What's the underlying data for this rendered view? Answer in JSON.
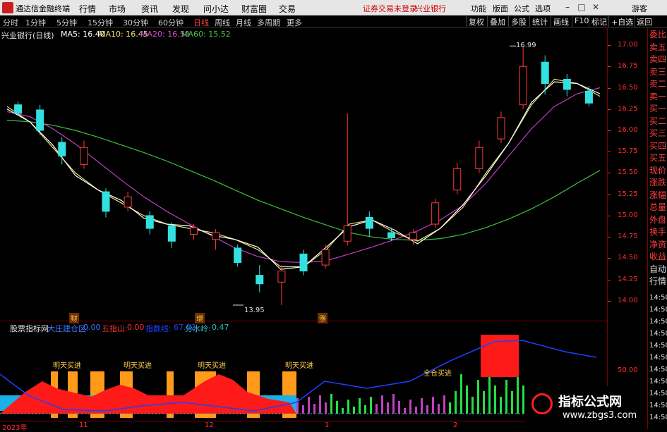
{
  "titlebar": {
    "app_name": "通达信金融终端",
    "menus": [
      "行情",
      "市场",
      "资讯",
      "发现",
      "问小达",
      "财富圈",
      "交易"
    ],
    "warning": "证券交易未登录",
    "stock": "兴业银行",
    "right_menus": [
      "功能",
      "版面",
      "公式",
      "选项"
    ],
    "guest": "游客"
  },
  "toolbar": {
    "periods": [
      "分时",
      "1分钟",
      "5分钟",
      "15分钟",
      "30分钟",
      "60分钟",
      "日线",
      "周线",
      "月线",
      "多周期",
      "更多"
    ],
    "active_period": "日线",
    "right_tools": [
      "复权",
      "叠加",
      "多股",
      "统计",
      "画线",
      "F10",
      "标记",
      "+自选",
      "返回"
    ]
  },
  "legend": {
    "stock_title": "兴业银行(日线)",
    "ma5": "MA5: 16.40",
    "ma10": "MA10: 16.45",
    "ma20": "MA20: 16.50",
    "ma60": "MA60: 15.52"
  },
  "price_axis": [
    "17.00",
    "16.75",
    "16.50",
    "16.25",
    "16.00",
    "15.75",
    "15.50",
    "15.25",
    "15.00",
    "14.75",
    "14.50",
    "14.25",
    "14.00"
  ],
  "annotations": {
    "high": "16.99",
    "low": "13.95",
    "tags": [
      "财",
      "增",
      "涨"
    ]
  },
  "indicator": {
    "name": "股票指标网",
    "items": [
      {
        "label": "大庄建仓区:",
        "value": "0.00",
        "color": "#3a78ff"
      },
      {
        "label": "五指山:",
        "value": "0.00",
        "color": "#ff3030"
      },
      {
        "label": "指数线:",
        "value": "67.82",
        "color": "#2040ff"
      },
      {
        "label": "分水岭:",
        "value": "0.47",
        "color": "#30c0c0"
      }
    ],
    "signals": [
      "明天买进",
      "明天买进",
      "明天买进",
      "明天买进"
    ],
    "full_position": "全仓买进",
    "axis": [
      "50.00"
    ]
  },
  "side_panel": [
    "委比",
    "卖五",
    "卖四",
    "卖三",
    "卖二",
    "卖一",
    "买一",
    "买二",
    "买三",
    "买四",
    "买五",
    "现价",
    "涨跌",
    "涨幅",
    "总量",
    "外盘",
    "换手",
    "净资",
    "收益",
    "自动",
    "行情"
  ],
  "side_right_axis": [
    "14:50",
    "14:50",
    "14:50",
    "14:50",
    "14:50",
    "14:50",
    "14:50",
    "14:50",
    "14:50",
    "14:50",
    "14:50"
  ],
  "date_axis": [
    "2023年",
    "11",
    "12",
    "1",
    "2"
  ],
  "watermark": {
    "title": "指标公式网",
    "url": "www.zbgs3.com"
  },
  "colors": {
    "up": "#ff3c3c",
    "down": "#33e0e0",
    "ma5": "#ffffff",
    "ma10": "#e8e070",
    "ma20": "#c040c0",
    "ma60": "#40c040"
  },
  "chart_data": {
    "type": "candlestick",
    "ylim": [
      13.9,
      17.05
    ],
    "ma60": [
      16.12,
      16.1,
      16.06,
      16.0,
      15.92,
      15.83,
      15.74,
      15.64,
      15.53,
      15.42,
      15.3,
      15.18,
      15.08,
      14.98,
      14.89,
      14.8,
      14.75,
      14.72,
      14.71,
      14.73,
      14.78,
      14.86,
      14.96,
      15.08,
      15.22,
      15.38,
      15.53
    ],
    "ma20": [
      16.22,
      16.16,
      16.02,
      15.84,
      15.63,
      15.42,
      15.22,
      15.05,
      14.9,
      14.76,
      14.62,
      14.52,
      14.46,
      14.45,
      14.47,
      14.55,
      14.63,
      14.72,
      14.82,
      14.95,
      15.12,
      15.38,
      15.7,
      16.02,
      16.28,
      16.43,
      16.5
    ],
    "ma5": [
      16.28,
      16.1,
      15.8,
      15.5,
      15.3,
      15.15,
      15.0,
      14.9,
      14.85,
      14.8,
      14.72,
      14.6,
      14.4,
      14.4,
      14.6,
      14.9,
      14.95,
      14.8,
      14.7,
      14.85,
      15.1,
      15.5,
      15.85,
      16.3,
      16.6,
      16.55,
      16.4
    ],
    "candles": [
      {
        "o": 16.3,
        "c": 16.2,
        "h": 16.34,
        "l": 16.17
      },
      {
        "o": 16.24,
        "c": 16.0,
        "h": 16.3,
        "l": 15.95
      },
      {
        "o": 15.86,
        "c": 15.7,
        "h": 15.92,
        "l": 15.6
      },
      {
        "o": 15.6,
        "c": 15.8,
        "h": 15.88,
        "l": 15.55
      },
      {
        "o": 15.28,
        "c": 15.05,
        "h": 15.32,
        "l": 14.98
      },
      {
        "o": 15.1,
        "c": 15.22,
        "h": 15.28,
        "l": 15.05
      },
      {
        "o": 15.0,
        "c": 14.85,
        "h": 15.05,
        "l": 14.78
      },
      {
        "o": 14.88,
        "c": 14.7,
        "h": 14.92,
        "l": 14.62
      },
      {
        "o": 14.78,
        "c": 14.86,
        "h": 14.9,
        "l": 14.72
      },
      {
        "o": 14.72,
        "c": 14.8,
        "h": 14.84,
        "l": 14.6
      },
      {
        "o": 14.62,
        "c": 14.45,
        "h": 14.66,
        "l": 14.4
      },
      {
        "o": 14.3,
        "c": 14.2,
        "h": 14.42,
        "l": 14.1
      },
      {
        "o": 14.22,
        "c": 14.35,
        "h": 14.42,
        "l": 13.95
      },
      {
        "o": 14.55,
        "c": 14.35,
        "h": 14.6,
        "l": 14.3
      },
      {
        "o": 14.42,
        "c": 14.6,
        "h": 14.66,
        "l": 14.38
      },
      {
        "o": 14.7,
        "c": 14.88,
        "h": 16.2,
        "l": 14.65
      },
      {
        "o": 14.98,
        "c": 14.85,
        "h": 15.05,
        "l": 14.75
      },
      {
        "o": 14.8,
        "c": 14.74,
        "h": 14.86,
        "l": 14.7
      },
      {
        "o": 14.72,
        "c": 14.8,
        "h": 14.84,
        "l": 14.66
      },
      {
        "o": 14.9,
        "c": 15.15,
        "h": 15.2,
        "l": 14.85
      },
      {
        "o": 15.3,
        "c": 15.55,
        "h": 15.62,
        "l": 15.25
      },
      {
        "o": 15.55,
        "c": 15.8,
        "h": 15.88,
        "l": 15.5
      },
      {
        "o": 15.9,
        "c": 16.15,
        "h": 16.22,
        "l": 15.85
      },
      {
        "o": 16.3,
        "c": 16.75,
        "h": 16.99,
        "l": 16.25
      },
      {
        "o": 16.8,
        "c": 16.55,
        "h": 16.88,
        "l": 16.42
      },
      {
        "o": 16.6,
        "c": 16.48,
        "h": 16.66,
        "l": 16.4
      },
      {
        "o": 16.46,
        "c": 16.32,
        "h": 16.52,
        "l": 16.28
      }
    ]
  }
}
